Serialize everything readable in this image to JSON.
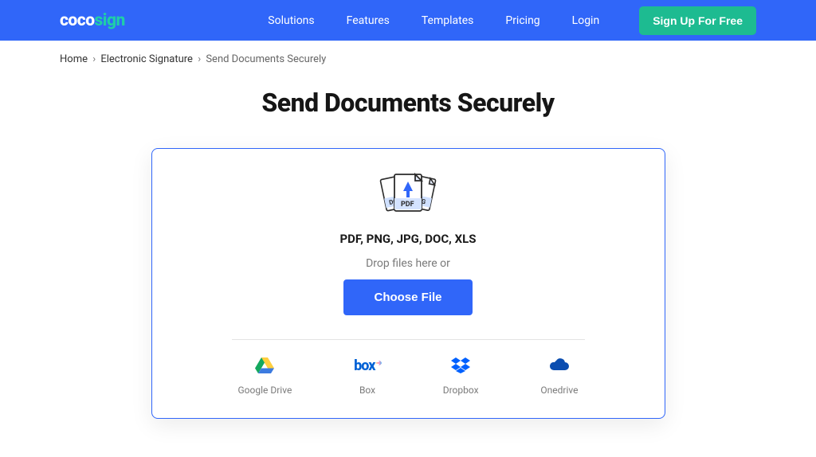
{
  "brand": {
    "coco": "coco",
    "sign": "sign"
  },
  "nav": {
    "solutions": "Solutions",
    "features": "Features",
    "templates": "Templates",
    "pricing": "Pricing",
    "login": "Login",
    "signup": "Sign Up For Free"
  },
  "breadcrumb": {
    "home": "Home",
    "electronic_signature": "Electronic Signature",
    "current": "Send Documents Securely"
  },
  "page": {
    "title": "Send Documents Securely",
    "formats": "PDF, PNG, JPG, DOC, XLS",
    "drop_text": "Drop files here or",
    "choose_file": "Choose File",
    "illustration_pdf": "PDF"
  },
  "providers": {
    "googledrive": "Google Drive",
    "box": "Box",
    "box_logo": "box",
    "dropbox": "Dropbox",
    "onedrive": "Onedrive"
  }
}
